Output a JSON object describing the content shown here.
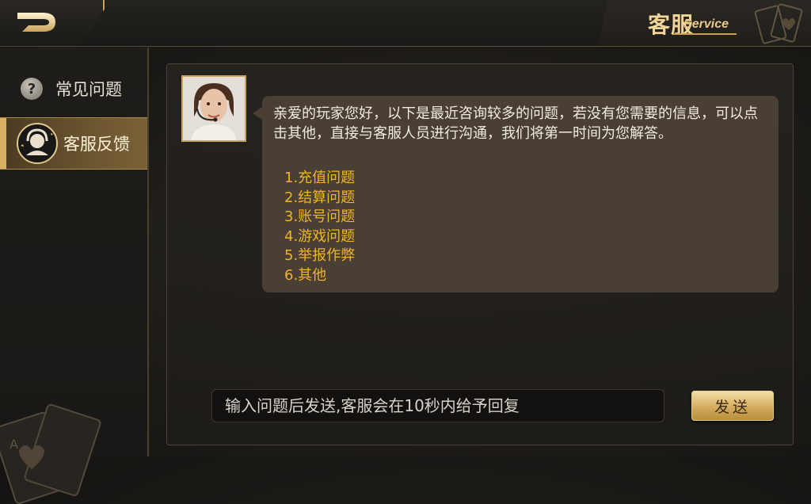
{
  "header": {
    "title": "客服",
    "subtitle": "Service"
  },
  "sidebar": {
    "items": [
      {
        "label": "常见问题",
        "icon": "question-icon",
        "active": false
      },
      {
        "label": "客服反馈",
        "icon": "headset-agent-icon",
        "active": true
      }
    ]
  },
  "chat": {
    "message": "亲爱的玩家您好，以下是最近咨询较多的问题，若没有您需要的信息，可以点击其他，直接与客服人员进行沟通，我们将第一时间为您解答。",
    "options": [
      "1.充值问题",
      "2.结算问题",
      "3.账号问题",
      "4.游戏问题",
      "5.举报作弊",
      "6.其他"
    ]
  },
  "input": {
    "placeholder": "输入问题后发送,客服会在10秒内给予回复",
    "value": ""
  },
  "send_button": {
    "label": "发送"
  },
  "colors": {
    "accent_gold": "#d8b163",
    "option_text": "#f0b428",
    "bubble_bg": "#4a3f34"
  }
}
